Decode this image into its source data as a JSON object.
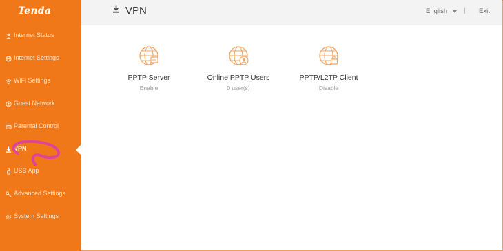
{
  "brand": {
    "logo_text": "Tenda",
    "accent": "#f07818"
  },
  "sidebar": {
    "items": [
      {
        "label": "Internet Status",
        "icon": "person-icon"
      },
      {
        "label": "Internet Settings",
        "icon": "globe-icon"
      },
      {
        "label": "WiFi Settings",
        "icon": "wifi-icon"
      },
      {
        "label": "Guest Network",
        "icon": "guest-icon"
      },
      {
        "label": "Parental Control",
        "icon": "parental-icon"
      },
      {
        "label": "VPN",
        "icon": "vpn-icon",
        "active": true
      },
      {
        "label": "USB App",
        "icon": "usb-icon"
      },
      {
        "label": "Advanced Settings",
        "icon": "tools-icon"
      },
      {
        "label": "System Settings",
        "icon": "gear-icon"
      }
    ]
  },
  "header": {
    "title": "VPN",
    "language": "English",
    "divider": "|",
    "exit_label": "Exit"
  },
  "cards": [
    {
      "title": "PPTP Server",
      "status": "Enable",
      "icon": "globe-server-icon"
    },
    {
      "title": "Online PPTP Users",
      "status": "0 user(s)",
      "icon": "globe-user-icon"
    },
    {
      "title": "PPTP/L2TP Client",
      "status": "Disable",
      "icon": "globe-lock-icon"
    }
  ]
}
